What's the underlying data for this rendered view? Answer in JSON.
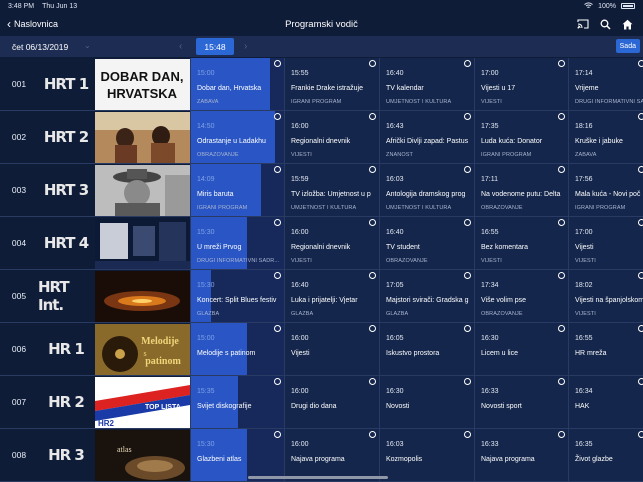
{
  "status": {
    "time": "3:48 PM",
    "date": "Thu Jun 13",
    "battery": "100%"
  },
  "nav": {
    "back_label": "Naslovnica",
    "title": "Programski vodič"
  },
  "datebar": {
    "date": "čet 06/13/2019",
    "current_time": "15:48",
    "now_label": "Sada"
  },
  "colors": {
    "background": "#0f1c38",
    "accent": "#2c67d6",
    "progress": "#2a56c5",
    "cell": "#14264b"
  },
  "channels": [
    {
      "number": "001",
      "logo": "HRT 1",
      "thumb": "dobar-dan",
      "programs": [
        {
          "time": "15:00",
          "title": "Dobar dan, Hrvatska",
          "genre": "ZABAVA",
          "progress": 0.85
        },
        {
          "time": "15:55",
          "title": "Frankie Drake istražuje",
          "genre": "IGRANI PROGRAM"
        },
        {
          "time": "16:40",
          "title": "TV kalendar",
          "genre": "UMJETNOST I KULTURA"
        },
        {
          "time": "17:00",
          "title": "Vijesti u 17",
          "genre": "VIJESTI"
        },
        {
          "time": "17:14",
          "title": "Vrijeme",
          "genre": "DRUGI INFORMATIVNI SADR..."
        }
      ]
    },
    {
      "number": "002",
      "logo": "HRT 2",
      "thumb": "ladakh",
      "programs": [
        {
          "time": "14:50",
          "title": "Odrastanje u Ladakhu",
          "genre": "OBRAZOVANJE",
          "progress": 0.9
        },
        {
          "time": "16:00",
          "title": "Regionalni dnevnik",
          "genre": "VIJESTI"
        },
        {
          "time": "16:43",
          "title": "Afrički Divlji zapad: Pastus",
          "genre": "ZNANOST"
        },
        {
          "time": "17:35",
          "title": "Luda kuća: Donator",
          "genre": "IGRANI PROGRAM"
        },
        {
          "time": "18:16",
          "title": "Kruške i jabuke",
          "genre": "ZABAVA"
        }
      ]
    },
    {
      "number": "003",
      "logo": "HRT 3",
      "thumb": "western",
      "programs": [
        {
          "time": "14:09",
          "title": "Miris baruta",
          "genre": "IGRANI PROGRAM",
          "progress": 0.75
        },
        {
          "time": "15:59",
          "title": "TV izložba: Umjetnost u p",
          "genre": "UMJETNOST I KULTURA"
        },
        {
          "time": "16:03",
          "title": "Antologija dramskog prog",
          "genre": "UMJETNOST I KULTURA"
        },
        {
          "time": "17:11",
          "title": "Na vodenome putu: Delta",
          "genre": "OBRAZOVANJE"
        },
        {
          "time": "17:56",
          "title": "Mala kuća - Novi poč",
          "genre": "IGRANI PROGRAM"
        }
      ]
    },
    {
      "number": "004",
      "logo": "HRT 4",
      "thumb": "u-mrezi",
      "programs": [
        {
          "time": "15:30",
          "title": "U mreži Prvog",
          "genre": "DRUGI INFORMATIVNI SADR...",
          "progress": 0.6
        },
        {
          "time": "16:00",
          "title": "Regionalni dnevnik",
          "genre": "VIJESTI"
        },
        {
          "time": "16:40",
          "title": "TV student",
          "genre": "OBRAZOVANJE"
        },
        {
          "time": "16:55",
          "title": "Bez komentara",
          "genre": "VIJESTI"
        },
        {
          "time": "17:00",
          "title": "Vijesti",
          "genre": "VIJESTI"
        }
      ]
    },
    {
      "number": "005",
      "logo": "HRT Int.",
      "thumb": "blues",
      "programs": [
        {
          "time": "15:30",
          "title": "Koncert: Split Blues festiv",
          "genre": "GLAZBA",
          "progress": 0.22
        },
        {
          "time": "16:40",
          "title": "Luka i prijatelji: Vjetar",
          "genre": "GLAZBA"
        },
        {
          "time": "17:05",
          "title": "Majstori svirači: Gradska g",
          "genre": "GLAZBA"
        },
        {
          "time": "17:34",
          "title": "Više volim pse",
          "genre": "OBRAZOVANJE"
        },
        {
          "time": "18:02",
          "title": "Vijesti na španjolskom",
          "genre": "VIJESTI"
        }
      ]
    },
    {
      "number": "006",
      "logo": "HR 1",
      "thumb": "melodije",
      "programs": [
        {
          "time": "15:00",
          "title": "Melodije s patinom",
          "genre": "",
          "progress": 0.6
        },
        {
          "time": "16:00",
          "title": "Vijesti",
          "genre": ""
        },
        {
          "time": "16:05",
          "title": "Iskustvo prostora",
          "genre": ""
        },
        {
          "time": "16:30",
          "title": "Licem u lice",
          "genre": ""
        },
        {
          "time": "16:55",
          "title": "HR mreža",
          "genre": ""
        }
      ]
    },
    {
      "number": "007",
      "logo": "HR 2",
      "thumb": "top-lista",
      "programs": [
        {
          "time": "15:35",
          "title": "Svijet diskografije",
          "genre": "",
          "progress": 0.5
        },
        {
          "time": "16:00",
          "title": "Drugi dio dana",
          "genre": ""
        },
        {
          "time": "16:30",
          "title": "Novosti",
          "genre": ""
        },
        {
          "time": "16:33",
          "title": "Novosti sport",
          "genre": ""
        },
        {
          "time": "16:34",
          "title": "HAK",
          "genre": ""
        }
      ]
    },
    {
      "number": "008",
      "logo": "HR 3",
      "thumb": "atlas",
      "programs": [
        {
          "time": "15:30",
          "title": "Glazbeni atlas",
          "genre": "",
          "progress": 0.6
        },
        {
          "time": "16:00",
          "title": "Najava programa",
          "genre": ""
        },
        {
          "time": "16:03",
          "title": "Kozmopolis",
          "genre": ""
        },
        {
          "time": "16:33",
          "title": "Najava programa",
          "genre": ""
        },
        {
          "time": "16:35",
          "title": "Život glazbe",
          "genre": ""
        }
      ]
    }
  ],
  "thumb_text": {
    "dobar_dan_line1": "DOBAR DAN,",
    "dobar_dan_line2": "HRVATSKA",
    "melodije_line1": "Melodije",
    "melodije_line2": "patinom",
    "melodije_s": "s",
    "top_lista": "TOP LISTA",
    "hr2": "HR2",
    "atlas": "atlas"
  }
}
